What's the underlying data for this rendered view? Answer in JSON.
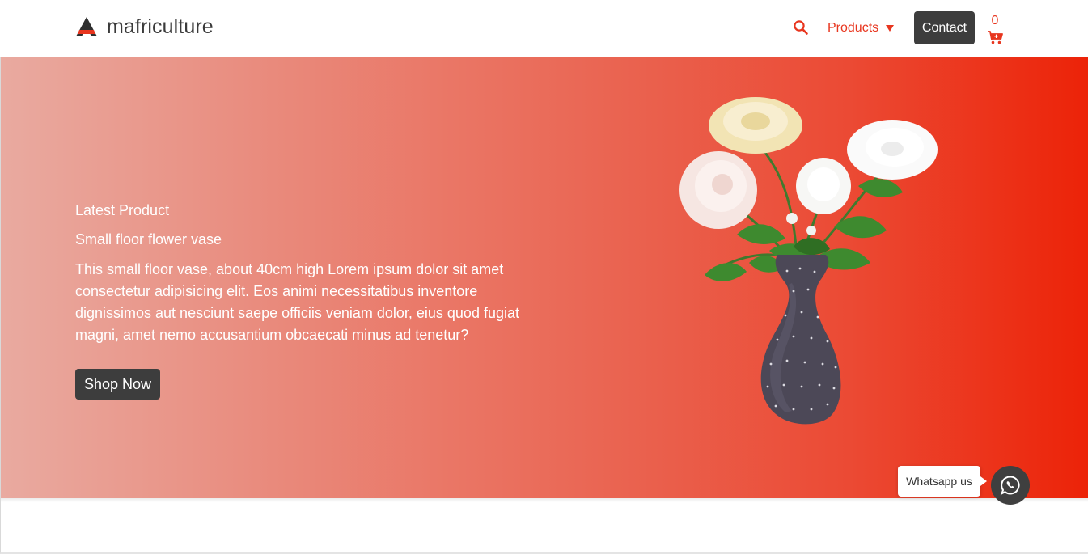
{
  "brand": {
    "name": "mafriculture",
    "logo_icon": "mafriculture-logo"
  },
  "nav": {
    "search_icon": "search-icon",
    "products_label": "Products",
    "contact_label": "Contact",
    "cart_count": "0",
    "cart_icon": "cart-icon"
  },
  "hero": {
    "eyebrow": "Latest Product",
    "title": "Small floor flower vase",
    "description": "This small floor vase, about 40cm high Lorem ipsum dolor sit amet consectetur adipisicing elit. Eos animi necessitatibus inventore dignissimos aut nesciunt saepe officiis veniam dolor, eius quod fugiat magni, amet nemo accusantium obcaecati minus ad tenetur?",
    "cta_label": "Shop Now",
    "image": "flower-vase-image"
  },
  "whatsapp": {
    "label": "Whatsapp us",
    "icon": "whatsapp-icon"
  },
  "colors": {
    "accent": "#e8361f",
    "dark_button": "#3d3d3d",
    "hero_gradient_start": "#e9aaa0",
    "hero_gradient_end": "#ec2308"
  }
}
